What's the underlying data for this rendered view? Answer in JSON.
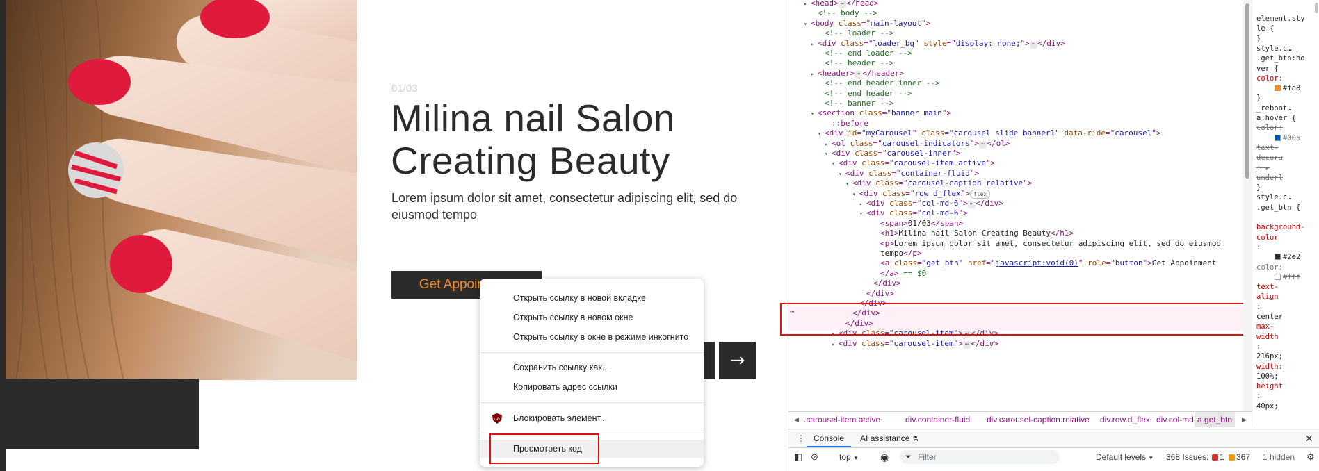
{
  "webpage": {
    "slide_number": "01/03",
    "title": "Milina nail Salon Creating Beauty",
    "text": "Lorem ipsum dolor sit amet, consectetur adipiscing elit, sed do eiusmod tempo",
    "button_label": "Get Appoinment",
    "next_arrow": "→"
  },
  "context_menu": {
    "items": [
      "Открыть ссылку в новой вкладке",
      "Открыть ссылку в новом окне",
      "Открыть ссылку в окне в режиме инкогнито",
      "Сохранить ссылку как...",
      "Копировать адрес ссылки",
      "Блокировать элемент...",
      "Просмотреть код"
    ]
  },
  "devtools": {
    "dom": [
      {
        "indent": 0,
        "tri": "▸",
        "parts": [
          [
            "tag",
            "<head>"
          ],
          [
            "ell",
            "⋯"
          ],
          [
            "tag",
            "</head>"
          ]
        ]
      },
      {
        "indent": 1,
        "tri": "",
        "parts": [
          [
            "cmt",
            "<!-- body -->"
          ]
        ]
      },
      {
        "indent": 0,
        "tri": "▾",
        "parts": [
          [
            "tag",
            "<body "
          ],
          [
            "attr",
            "class"
          ],
          [
            "tag",
            "=\""
          ],
          [
            "val",
            "main-layout"
          ],
          [
            "tag",
            "\">"
          ]
        ]
      },
      {
        "indent": 2,
        "tri": "",
        "parts": [
          [
            "cmt",
            "<!-- loader  -->"
          ]
        ]
      },
      {
        "indent": 1,
        "tri": "▸",
        "parts": [
          [
            "tag",
            "<div "
          ],
          [
            "attr",
            "class"
          ],
          [
            "tag",
            "=\""
          ],
          [
            "val",
            "loader_bg"
          ],
          [
            "tag",
            "\" "
          ],
          [
            "attr",
            "style"
          ],
          [
            "tag",
            "=\""
          ],
          [
            "val",
            "display: none;"
          ],
          [
            "tag",
            "\">"
          ],
          [
            "ell",
            "⋯"
          ],
          [
            "tag",
            "</div>"
          ]
        ]
      },
      {
        "indent": 2,
        "tri": "",
        "parts": [
          [
            "cmt",
            "<!-- end loader -->"
          ]
        ]
      },
      {
        "indent": 2,
        "tri": "",
        "parts": [
          [
            "cmt",
            "<!-- header -->"
          ]
        ]
      },
      {
        "indent": 1,
        "tri": "▸",
        "parts": [
          [
            "tag",
            "<header>"
          ],
          [
            "ell",
            "⋯"
          ],
          [
            "tag",
            "</header>"
          ]
        ]
      },
      {
        "indent": 2,
        "tri": "",
        "parts": [
          [
            "cmt",
            "<!-- end header inner -->"
          ]
        ]
      },
      {
        "indent": 2,
        "tri": "",
        "parts": [
          [
            "cmt",
            "<!-- end header -->"
          ]
        ]
      },
      {
        "indent": 2,
        "tri": "",
        "parts": [
          [
            "cmt",
            "<!-- banner -->"
          ]
        ]
      },
      {
        "indent": 1,
        "tri": "▾",
        "parts": [
          [
            "tag",
            "<section "
          ],
          [
            "attr",
            "class"
          ],
          [
            "tag",
            "=\""
          ],
          [
            "val",
            "banner_main"
          ],
          [
            "tag",
            "\">"
          ]
        ]
      },
      {
        "indent": 3,
        "tri": "",
        "parts": [
          [
            "tag",
            "::before"
          ]
        ]
      },
      {
        "indent": 2,
        "tri": "▾",
        "parts": [
          [
            "tag",
            "<div "
          ],
          [
            "attr",
            "id"
          ],
          [
            "tag",
            "=\""
          ],
          [
            "val",
            "myCarousel"
          ],
          [
            "tag",
            "\" "
          ],
          [
            "attr",
            "class"
          ],
          [
            "tag",
            "=\""
          ],
          [
            "val",
            "carousel slide banner1"
          ],
          [
            "tag",
            "\" "
          ],
          [
            "attr",
            "data-ride"
          ],
          [
            "tag",
            "=\""
          ],
          [
            "val",
            "carousel"
          ],
          [
            "tag",
            "\">"
          ]
        ]
      },
      {
        "indent": 3,
        "tri": "▸",
        "parts": [
          [
            "tag",
            "<ol "
          ],
          [
            "attr",
            "class"
          ],
          [
            "tag",
            "=\""
          ],
          [
            "val",
            "carousel-indicators"
          ],
          [
            "tag",
            "\">"
          ],
          [
            "ell",
            "⋯"
          ],
          [
            "tag",
            "</ol>"
          ]
        ]
      },
      {
        "indent": 3,
        "tri": "▾",
        "parts": [
          [
            "tag",
            "<div "
          ],
          [
            "attr",
            "class"
          ],
          [
            "tag",
            "=\""
          ],
          [
            "val",
            "carousel-inner"
          ],
          [
            "tag",
            "\">"
          ]
        ]
      },
      {
        "indent": 4,
        "tri": "▾",
        "parts": [
          [
            "tag",
            "<div "
          ],
          [
            "attr",
            "class"
          ],
          [
            "tag",
            "=\""
          ],
          [
            "val",
            "carousel-item active"
          ],
          [
            "tag",
            "\">"
          ]
        ]
      },
      {
        "indent": 5,
        "tri": "▾",
        "parts": [
          [
            "tag",
            "<div "
          ],
          [
            "attr",
            "class"
          ],
          [
            "tag",
            "=\""
          ],
          [
            "val",
            "container-fluid"
          ],
          [
            "tag",
            "\">"
          ]
        ]
      },
      {
        "indent": 6,
        "tri": "▾",
        "parts": [
          [
            "tag",
            "<div "
          ],
          [
            "attr",
            "class"
          ],
          [
            "tag",
            "=\""
          ],
          [
            "val",
            "carousel-caption relative"
          ],
          [
            "tag",
            "\">"
          ]
        ]
      },
      {
        "indent": 7,
        "tri": "▾",
        "parts": [
          [
            "tag",
            "<div "
          ],
          [
            "attr",
            "class"
          ],
          [
            "tag",
            "=\""
          ],
          [
            "val",
            "row d_flex"
          ],
          [
            "tag",
            "\">"
          ],
          [
            "badge",
            "flex"
          ]
        ]
      },
      {
        "indent": 8,
        "tri": "▸",
        "parts": [
          [
            "tag",
            "<div "
          ],
          [
            "attr",
            "class"
          ],
          [
            "tag",
            "=\""
          ],
          [
            "val",
            "col-md-6"
          ],
          [
            "tag",
            "\">"
          ],
          [
            "ell",
            "⋯"
          ],
          [
            "tag",
            "</div>"
          ]
        ]
      },
      {
        "indent": 8,
        "tri": "▾",
        "parts": [
          [
            "tag",
            "<div "
          ],
          [
            "attr",
            "class"
          ],
          [
            "tag",
            "=\""
          ],
          [
            "val",
            "col-md-6"
          ],
          [
            "tag",
            "\">"
          ]
        ]
      },
      {
        "indent": 10,
        "tri": "",
        "parts": [
          [
            "tag",
            "<span>"
          ],
          [
            "text",
            "01/03"
          ],
          [
            "tag",
            "</span>"
          ]
        ]
      },
      {
        "indent": 10,
        "tri": "",
        "parts": [
          [
            "tag",
            "<h1>"
          ],
          [
            "text",
            "Milina nail Salon Creating Beauty"
          ],
          [
            "tag",
            "</h1>"
          ]
        ]
      },
      {
        "indent": 10,
        "tri": "",
        "parts": [
          [
            "tag",
            "<p>"
          ],
          [
            "text",
            "Lorem ipsum dolor sit amet, consectetur adipiscing elit, sed do eiusmod"
          ]
        ]
      },
      {
        "indent": 10,
        "tri": "",
        "parts": [
          [
            "text",
            "tempo"
          ],
          [
            "tag",
            "</p>"
          ]
        ]
      },
      {
        "indent": 10,
        "tri": "",
        "parts": [
          [
            "tag",
            "<a "
          ],
          [
            "attr",
            "class"
          ],
          [
            "tag",
            "=\""
          ],
          [
            "val",
            "get_btn"
          ],
          [
            "tag",
            "\" "
          ],
          [
            "attr",
            "href"
          ],
          [
            "tag",
            "=\""
          ],
          [
            "link",
            "javascript:void(0)"
          ],
          [
            "tag",
            "\" "
          ],
          [
            "attr",
            "role"
          ],
          [
            "tag",
            "=\""
          ],
          [
            "val",
            "button"
          ],
          [
            "tag",
            "\">"
          ],
          [
            "text",
            "Get Appoinment"
          ]
        ]
      },
      {
        "indent": 10,
        "tri": "",
        "parts": [
          [
            "tag",
            "</a>"
          ],
          [
            "cmt",
            " == $0"
          ]
        ]
      },
      {
        "indent": 9,
        "tri": "",
        "parts": [
          [
            "tag",
            "</div>"
          ]
        ]
      },
      {
        "indent": 8,
        "tri": "",
        "parts": [
          [
            "tag",
            "</div>"
          ]
        ]
      },
      {
        "indent": 7,
        "tri": "",
        "parts": [
          [
            "tag",
            "</div>"
          ]
        ]
      },
      {
        "indent": 6,
        "tri": "",
        "parts": [
          [
            "tag",
            "</div>"
          ]
        ]
      },
      {
        "indent": 5,
        "tri": "",
        "parts": [
          [
            "tag",
            "</div>"
          ]
        ]
      },
      {
        "indent": 4,
        "tri": "▸",
        "parts": [
          [
            "tag",
            "<div "
          ],
          [
            "attr",
            "class"
          ],
          [
            "tag",
            "=\""
          ],
          [
            "val",
            "carousel-item"
          ],
          [
            "tag",
            "\">"
          ],
          [
            "ell",
            "⋯"
          ],
          [
            "tag",
            "</div>"
          ]
        ]
      },
      {
        "indent": 4,
        "tri": "▸",
        "parts": [
          [
            "tag",
            "<div "
          ],
          [
            "attr",
            "class"
          ],
          [
            "tag",
            "=\""
          ],
          [
            "val",
            "carousel-item"
          ],
          [
            "tag",
            "\">"
          ],
          [
            "ell",
            "⋯"
          ],
          [
            "tag",
            "</div>"
          ]
        ]
      }
    ],
    "styles": [
      [
        "sel",
        "element.sty"
      ],
      [
        "sel",
        "le {"
      ],
      [
        "sel",
        "}"
      ],
      [
        "src",
        "     style.c…"
      ],
      [
        "sel",
        ".get_btn:ho"
      ],
      [
        "sel",
        "ver {"
      ],
      [
        "prop",
        "  color:"
      ],
      [
        "swatch",
        "#fa8"
      ],
      [
        "sel",
        "}"
      ],
      [
        "src",
        "     _reboot…"
      ],
      [
        "sel",
        "a:hover {"
      ],
      [
        "struck",
        "  color:"
      ],
      [
        "swatch2",
        "#005"
      ],
      [
        "struck",
        "  text-"
      ],
      [
        "struck",
        "  decora"
      ],
      [
        "struck",
        "  : ▸"
      ],
      [
        "struck",
        "  underl"
      ],
      [
        "sel",
        "}"
      ],
      [
        "src",
        "     style.c…"
      ],
      [
        "sel",
        ".get_btn {"
      ],
      [
        "blank",
        ""
      ],
      [
        "prop",
        "background-"
      ],
      [
        "prop",
        "  color"
      ],
      [
        "sel",
        "  :"
      ],
      [
        "swatch3",
        "#2e2"
      ],
      [
        "struck",
        "color:"
      ],
      [
        "swatch4",
        "#fff"
      ],
      [
        "prop",
        "text-"
      ],
      [
        "prop",
        "  align"
      ],
      [
        "sel",
        "  :"
      ],
      [
        "sel",
        "  center"
      ],
      [
        "prop",
        "max-"
      ],
      [
        "prop",
        "  width"
      ],
      [
        "sel",
        "  :"
      ],
      [
        "sel",
        "  216px;"
      ],
      [
        "prop",
        "width:"
      ],
      [
        "sel",
        "  100%;"
      ],
      [
        "prop",
        "height"
      ],
      [
        "sel",
        "  :"
      ],
      [
        "sel",
        "  40px;"
      ]
    ],
    "breadcrumbs": [
      ".carousel-item.active",
      "div.container-fluid",
      "div.carousel-caption.relative",
      "div.row.d_flex",
      "div.col-md-6",
      "a.get_btn"
    ],
    "drawer_tabs": {
      "console": "Console",
      "ai": "AI assistance"
    },
    "toolbar": {
      "context": "top",
      "filter_placeholder": "Filter",
      "levels": "Default levels",
      "issues_label": "368 Issues:",
      "errors": "1",
      "warnings": "367",
      "hidden": "1 hidden"
    }
  },
  "colors": {
    "dark": "#2b2b2b",
    "accent_orange": "#f18a1d",
    "highlight_red": "#dd1111"
  }
}
